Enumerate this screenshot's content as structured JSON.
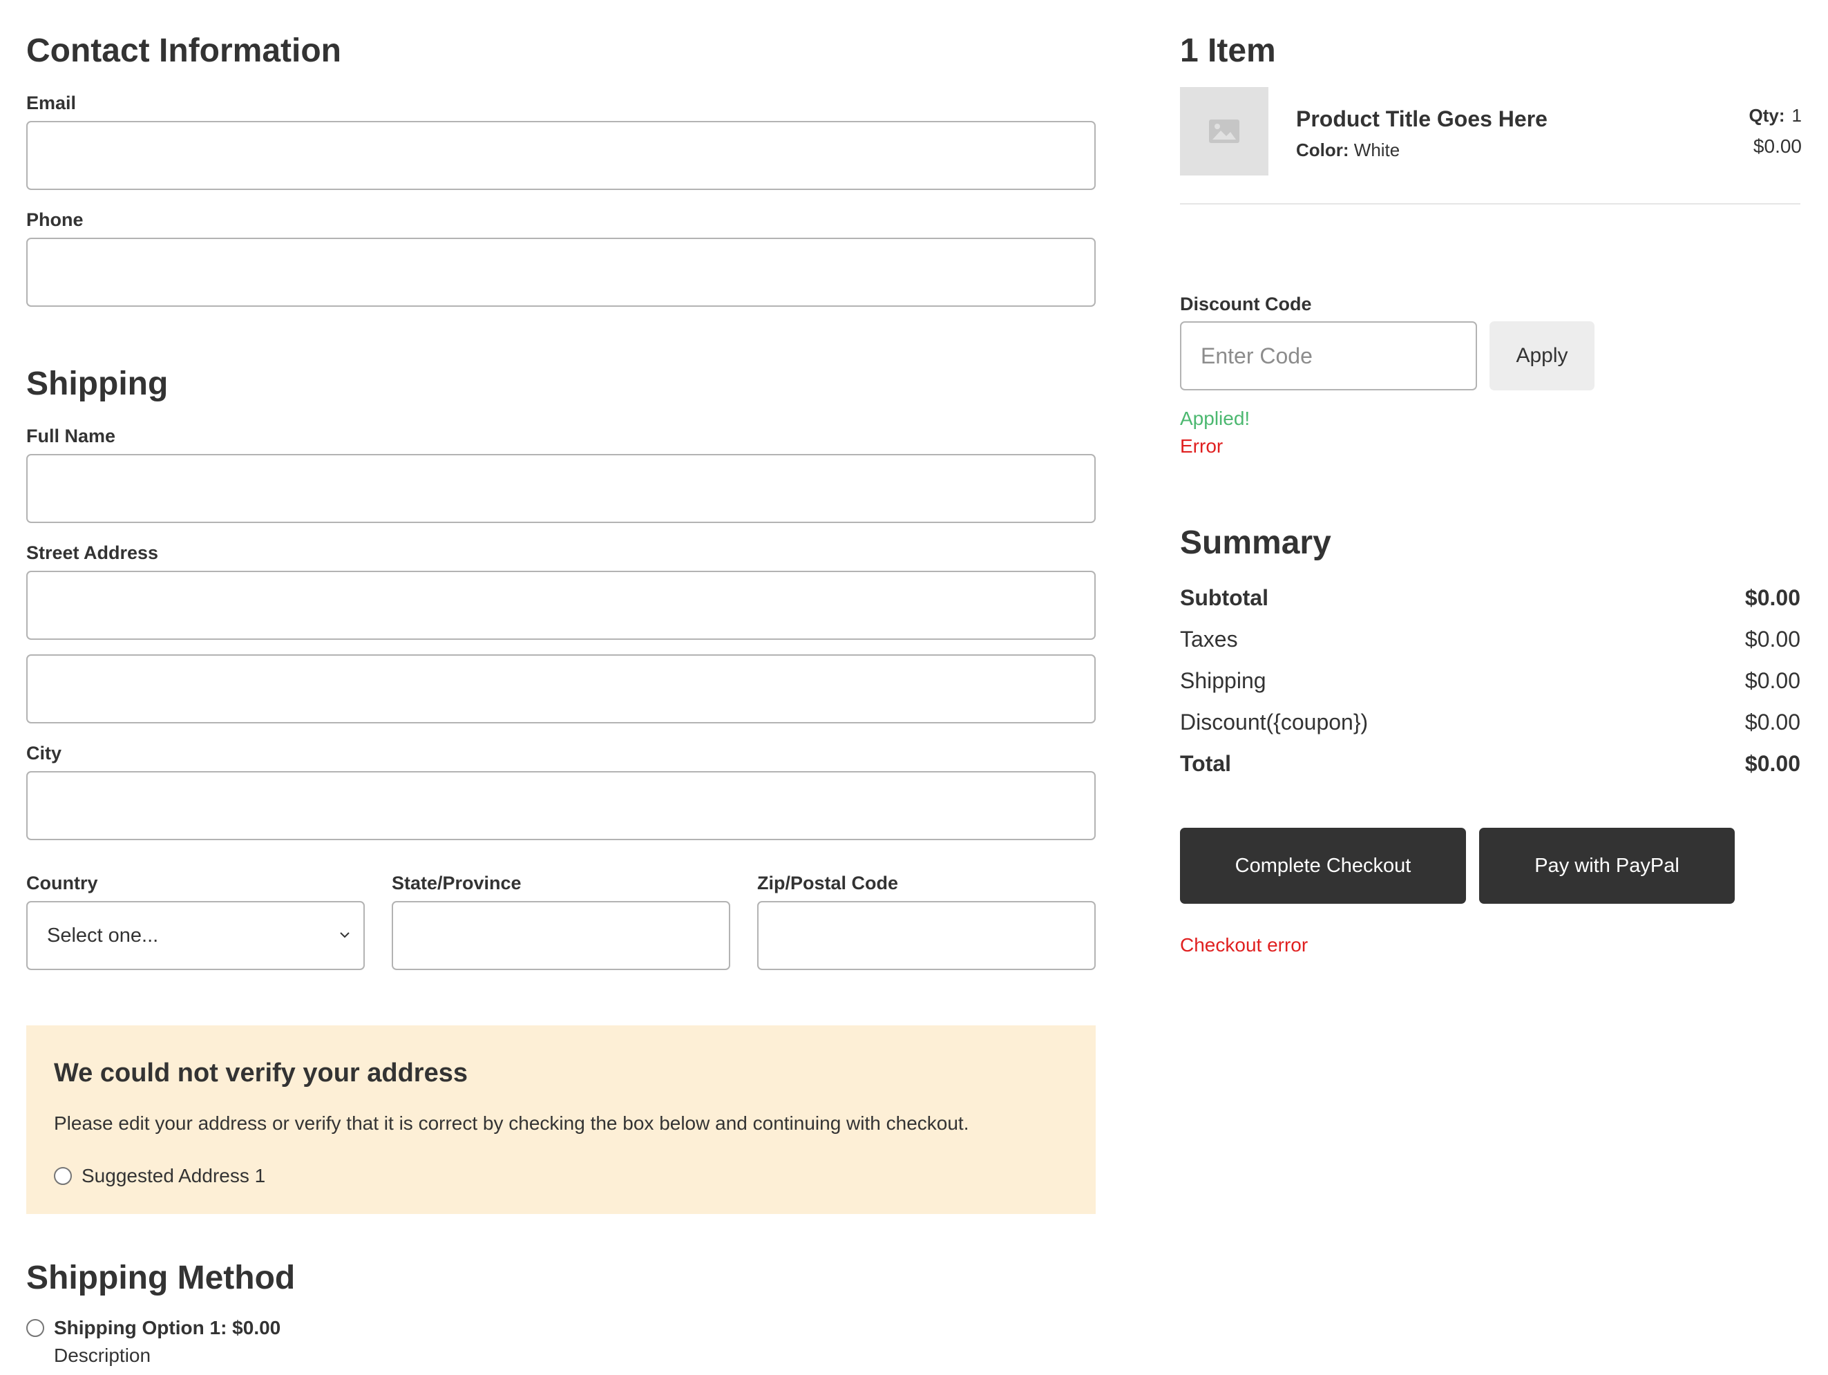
{
  "contact": {
    "heading": "Contact Information",
    "email_label": "Email",
    "email_value": "",
    "phone_label": "Phone",
    "phone_value": ""
  },
  "shipping": {
    "heading": "Shipping",
    "full_name_label": "Full Name",
    "street_label": "Street Address",
    "city_label": "City",
    "country_label": "Country",
    "country_selected": "Select one...",
    "state_label": "State/Province",
    "zip_label": "Zip/Postal Code"
  },
  "address_notice": {
    "title": "We could not verify your address",
    "message": "Please edit your address or verify that it is correct by checking the box below and continuing with checkout.",
    "suggestion": "Suggested Address 1",
    "background": "#fdefd6"
  },
  "shipping_method": {
    "heading": "Shipping Method",
    "option_title": "Shipping Option 1: $0.00",
    "option_description": "Description"
  },
  "cart": {
    "heading": "1 Item",
    "product_title": "Product Title Goes Here",
    "color_label": "Color:",
    "color_value": "White",
    "qty_label": "Qty:",
    "qty_value": "1",
    "price": "$0.00",
    "thumbnail_icon": "image-placeholder-icon"
  },
  "discount": {
    "label": "Discount Code",
    "placeholder": "Enter Code",
    "apply_label": "Apply",
    "success_message": "Applied!",
    "error_message": "Error",
    "success_color": "#4cb870",
    "error_color": "#e02020"
  },
  "summary": {
    "heading": "Summary",
    "rows": [
      {
        "label": "Subtotal",
        "value": "$0.00"
      },
      {
        "label": "Taxes",
        "value": "$0.00"
      },
      {
        "label": "Shipping",
        "value": "$0.00"
      },
      {
        "label": "Discount({coupon})",
        "value": "$0.00"
      },
      {
        "label": "Total",
        "value": "$0.00"
      }
    ]
  },
  "actions": {
    "complete_checkout": "Complete Checkout",
    "pay_paypal": "Pay with PayPal",
    "checkout_error": "Checkout error",
    "button_color": "#333333"
  }
}
